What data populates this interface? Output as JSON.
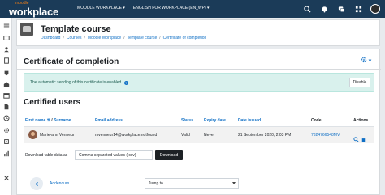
{
  "topbar": {
    "logo_small": "moodle",
    "logo_big": "workplace",
    "nav": [
      "MOODLE WORKPLACE ▾",
      "ENGLISH FOR WORKPLACE (EN_WP) ▾"
    ]
  },
  "course": {
    "title": "Template course",
    "breadcrumb": [
      "Dashboard",
      "Courses",
      "Moodle Workplace",
      "Template course",
      "Certificate of completion"
    ],
    "separator": "/"
  },
  "page": {
    "title": "Certificate of completion",
    "alert_text": "The automatic sending of this certificate is enabled.",
    "help_mark": "?",
    "disable_label": "Disable",
    "section_title": "Certified users"
  },
  "table": {
    "headers": {
      "first_name": "First name",
      "sort_mark": "⇅",
      "slash": "/",
      "surname": "Surname",
      "email": "Email address",
      "status": "Status",
      "expiry": "Expiry date",
      "issued": "Date issued",
      "code": "Code",
      "actions": "Actions"
    },
    "rows": [
      {
        "name": "Marie-ann Venneur",
        "email": "mvenneur14@workplace.notfound",
        "status": "Valid",
        "expiry": "Never",
        "issued": "21 September 2020, 2:03 PM",
        "code": "7324766548MV"
      }
    ]
  },
  "download": {
    "label": "Download table data as",
    "format": "Comma separated values (.csv)",
    "button": "Download"
  },
  "footer_nav": {
    "prev_label": "Addendum",
    "jump_placeholder": "Jump to..."
  },
  "colors": {
    "navbar": "#1b3b58",
    "link": "#0f6fc5",
    "alert_bg": "#d9f1ed"
  }
}
